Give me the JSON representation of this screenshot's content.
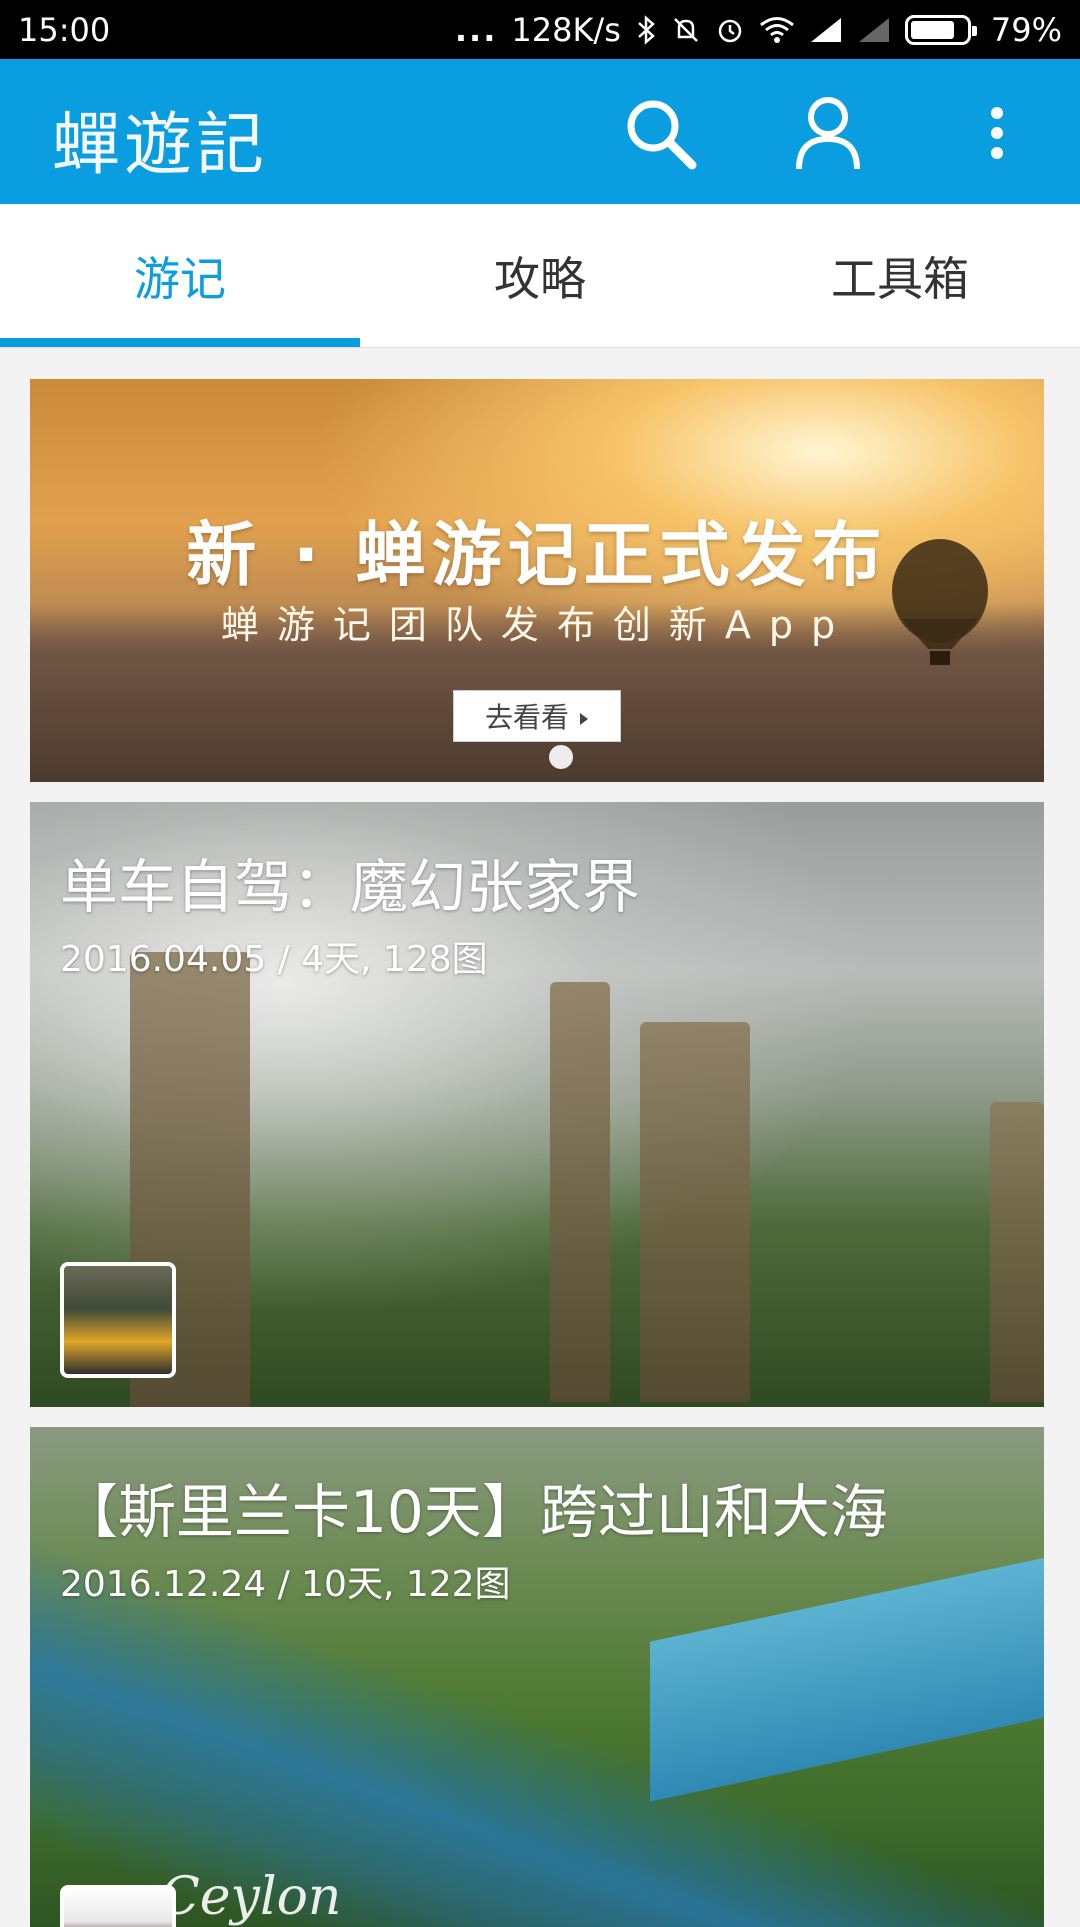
{
  "status_bar": {
    "time": "15:00",
    "dots": "...",
    "speed": "128K/s",
    "battery": "79%",
    "battery_level": 0.79
  },
  "app_bar": {
    "title": "蟬遊記",
    "search_icon": "search-icon",
    "user_icon": "user-icon",
    "more_icon": "more-vert-icon"
  },
  "tabs": [
    {
      "label": "游记",
      "active": true
    },
    {
      "label": "攻略",
      "active": false
    },
    {
      "label": "工具箱",
      "active": false
    }
  ],
  "banner": {
    "headline": "新 · 蝉游记正式发布",
    "subline": "蝉游记团队发布创新App",
    "cta_label": "去看看",
    "cta_icon": "triangle-right-icon"
  },
  "cards": [
    {
      "title": "单车自驾：魔幻张家界",
      "meta": "2016.04.05 / 4天, 128图"
    },
    {
      "title": "【斯里兰卡10天】跨过山和大海",
      "meta": "2016.12.24 / 10天, 122图",
      "watermark": "Ceylon"
    }
  ],
  "colors": {
    "primary": "#0a9ee0",
    "status_bar": "#000000",
    "background": "#f3f3f3"
  }
}
